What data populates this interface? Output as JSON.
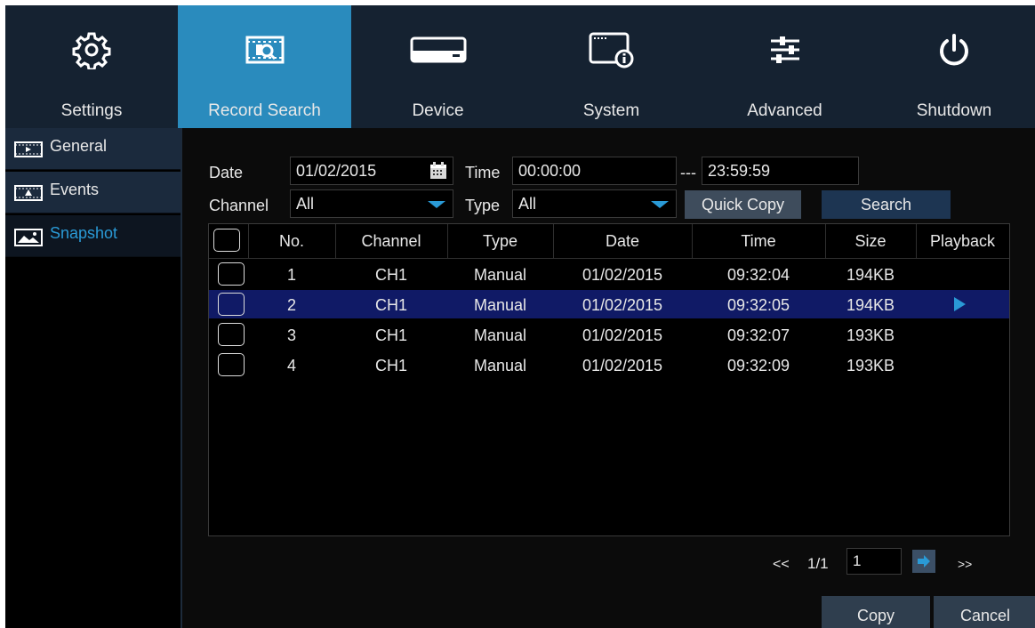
{
  "nav": {
    "items": [
      {
        "label": "Settings",
        "icon": "gear-icon"
      },
      {
        "label": "Record Search",
        "icon": "record-search-icon",
        "active": true
      },
      {
        "label": "Device",
        "icon": "hard-drive-icon"
      },
      {
        "label": "System",
        "icon": "system-info-icon"
      },
      {
        "label": "Advanced",
        "icon": "sliders-icon"
      },
      {
        "label": "Shutdown",
        "icon": "power-icon"
      }
    ]
  },
  "sidebar": {
    "items": [
      {
        "label": "General",
        "icon": "video-file-icon"
      },
      {
        "label": "Events",
        "icon": "event-file-icon"
      },
      {
        "label": "Snapshot",
        "icon": "image-icon",
        "active": true
      }
    ]
  },
  "filters": {
    "date_label": "Date",
    "date_value": "01/02/2015",
    "time_label": "Time",
    "time_start": "00:00:00",
    "time_sep": "---",
    "time_end": "23:59:59",
    "channel_label": "Channel",
    "channel_value": "All",
    "type_label": "Type",
    "type_value": "All",
    "quick_copy": "Quick Copy",
    "search": "Search"
  },
  "table": {
    "headers": [
      "No.",
      "Channel",
      "Type",
      "Date",
      "Time",
      "Size",
      "Playback"
    ],
    "rows": [
      {
        "no": "1",
        "channel": "CH1",
        "type": "Manual",
        "date": "01/02/2015",
        "time": "09:32:04",
        "size": "194KB",
        "playing": false
      },
      {
        "no": "2",
        "channel": "CH1",
        "type": "Manual",
        "date": "01/02/2015",
        "time": "09:32:05",
        "size": "194KB",
        "playing": true
      },
      {
        "no": "3",
        "channel": "CH1",
        "type": "Manual",
        "date": "01/02/2015",
        "time": "09:32:07",
        "size": "193KB",
        "playing": false
      },
      {
        "no": "4",
        "channel": "CH1",
        "type": "Manual",
        "date": "01/02/2015",
        "time": "09:32:09",
        "size": "193KB",
        "playing": false
      }
    ]
  },
  "pager": {
    "first": "<<",
    "page_info": "1/1",
    "page_input": "1",
    "last": ">>"
  },
  "footer": {
    "copy": "Copy",
    "cancel": "Cancel"
  },
  "colors": {
    "accent": "#2a8bbd",
    "nav_bg": "#152231",
    "selected_row": "#101a66"
  }
}
